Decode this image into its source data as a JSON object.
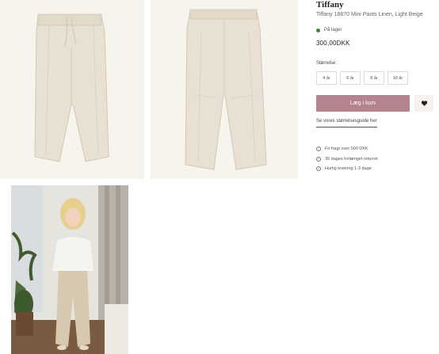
{
  "product": {
    "brand": "Tiffany",
    "name": "Tiffany 18870 Mini Pants Linen, Light Beige",
    "stock_status": "På lager",
    "price": "300,00DKK",
    "size_label": "Størrelse :",
    "sizes": [
      "4 år",
      "6 år",
      "8 år",
      "10 år"
    ],
    "add_to_cart": "Læg i kurv",
    "size_guide": "Se vores størrelsesguide her"
  },
  "perks": [
    "Fri fragt over 500 DKK",
    "30 dages forlænget returret",
    "Hurtig levering 1-3 dage"
  ],
  "gallery": {
    "images": [
      "linen-pants-front",
      "linen-pants-back",
      "model-wearing-pants"
    ]
  },
  "colors": {
    "accent": "#b5838e",
    "stock": "#2f8a3a",
    "fabric": "#e8e0d2"
  }
}
